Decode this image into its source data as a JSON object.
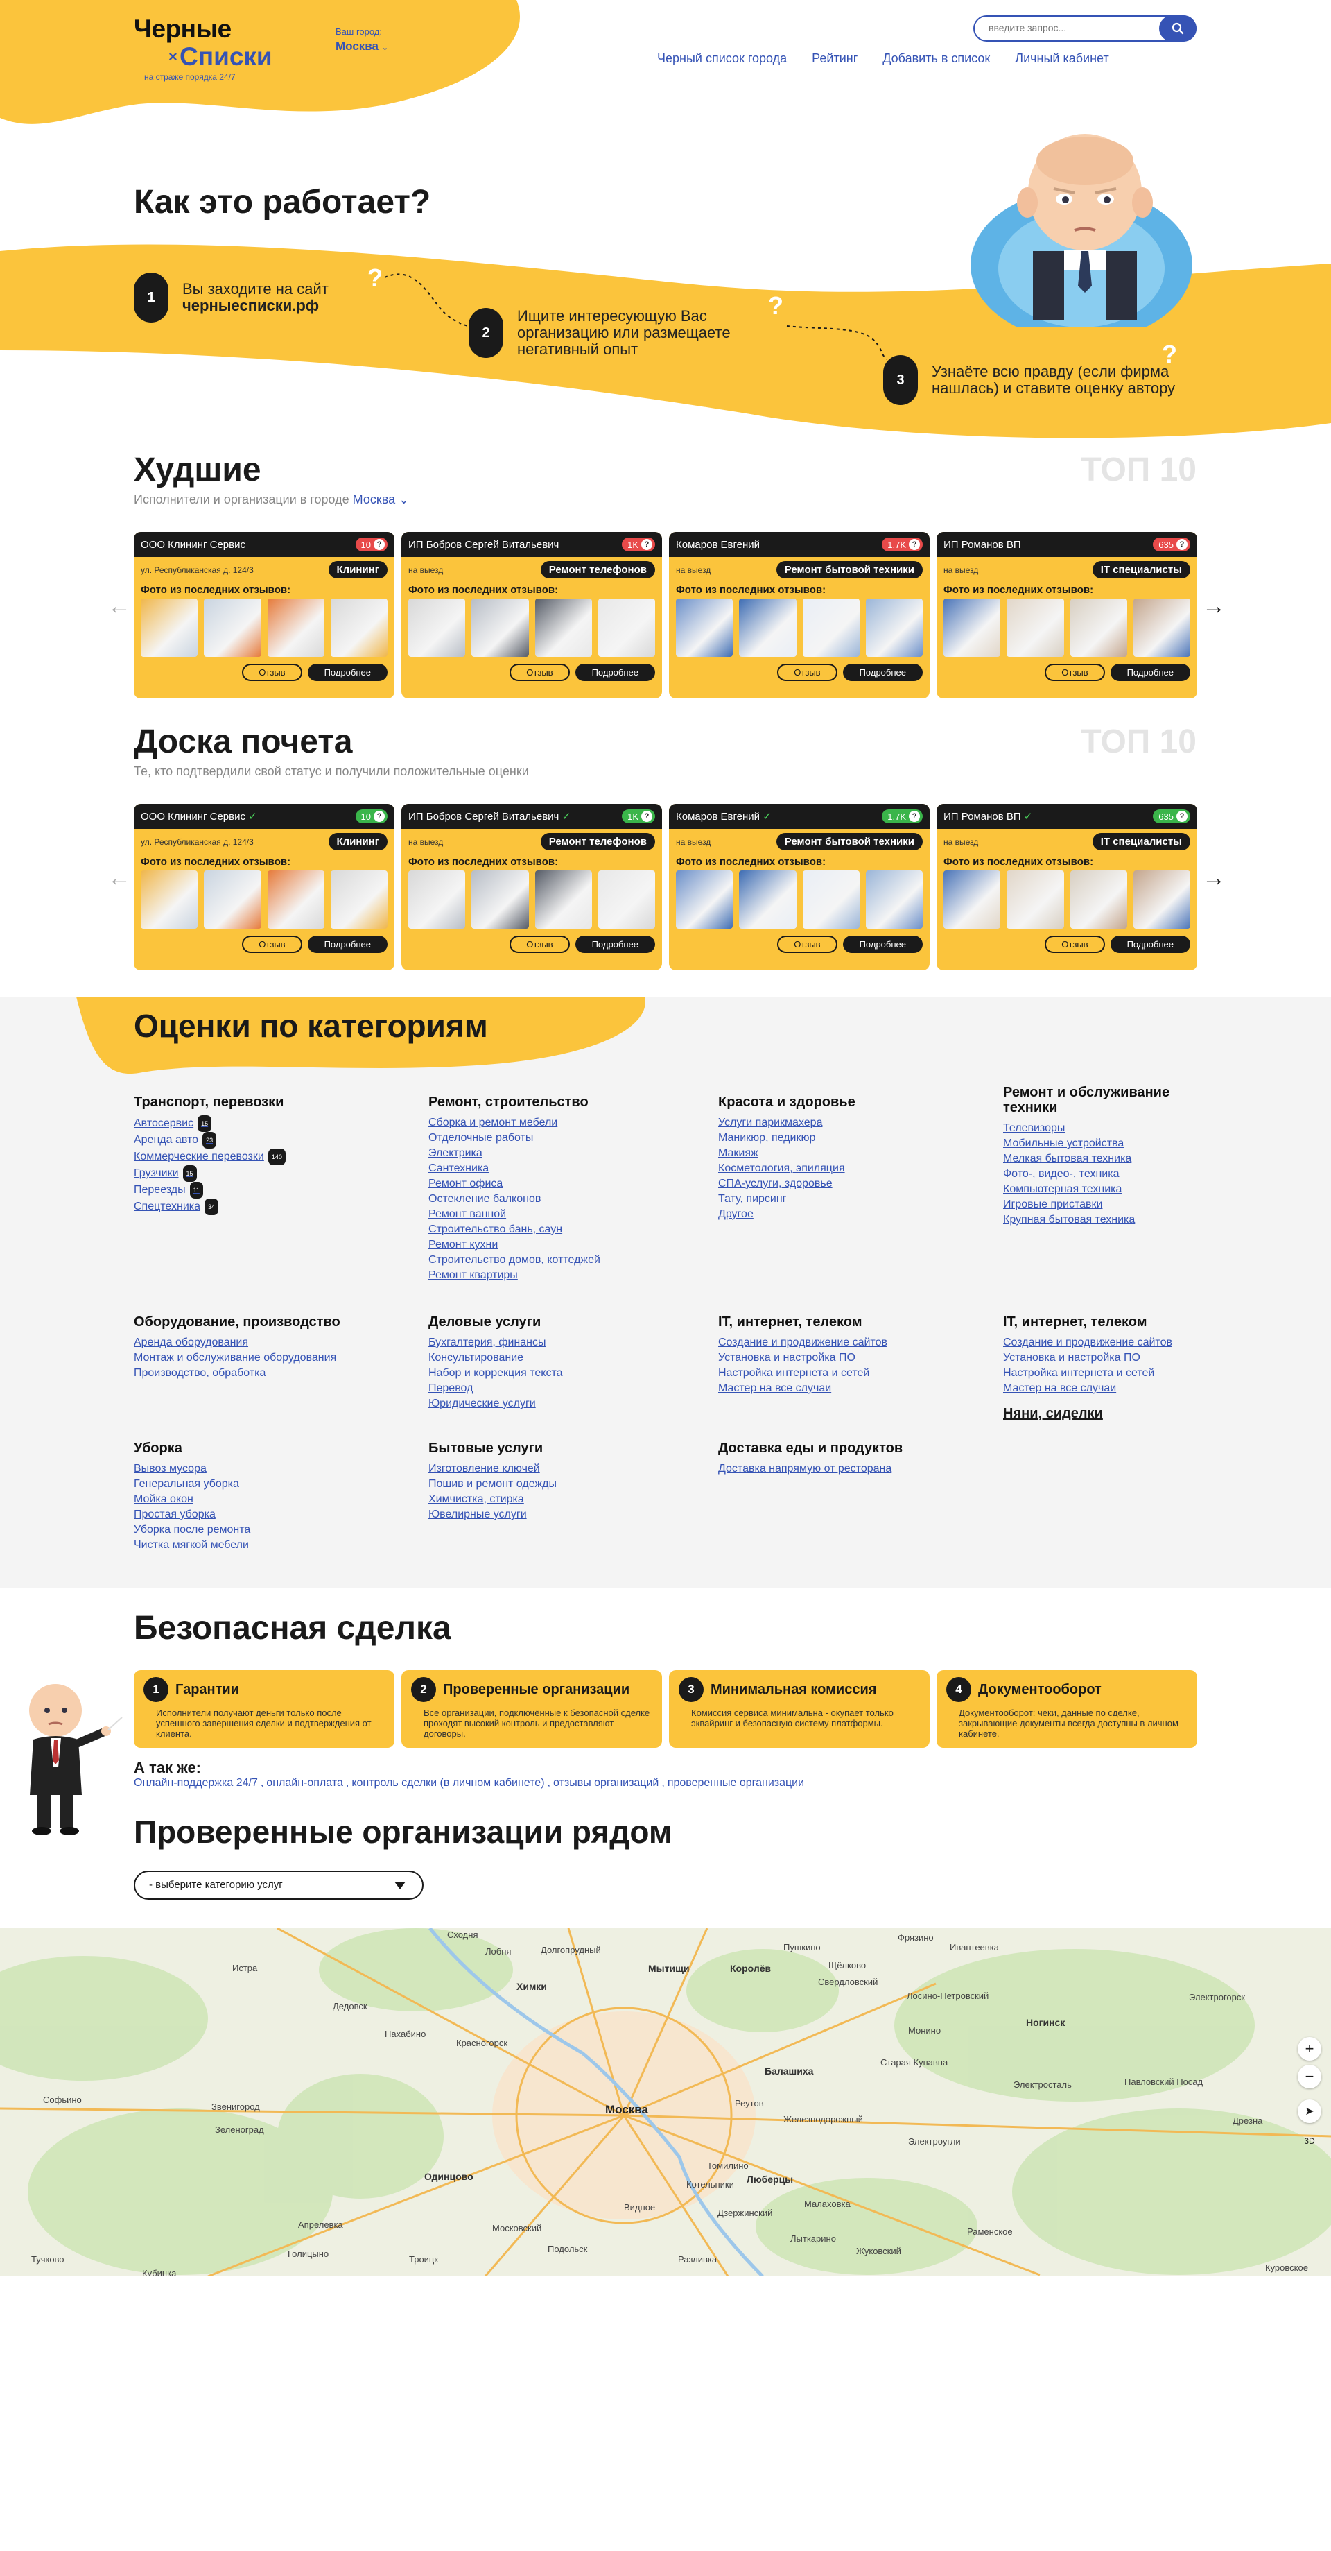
{
  "header": {
    "logo_line1": "Черные",
    "logo_line2": "Списки",
    "logo_mark": "×",
    "slogan": "на страже порядка 24/7",
    "city_label": "Ваш город:",
    "city_value": "Москва",
    "search_placeholder": "введите запрос...",
    "nav": [
      "Черный список города",
      "Рейтинг",
      "Добавить в список",
      "Личный кабинет"
    ]
  },
  "how": {
    "title": "Как это работает?",
    "steps": [
      {
        "num": "1",
        "text": "Вы заходите на сайт",
        "bold": "черныесписки.рф"
      },
      {
        "num": "2",
        "text": "Ищите интересующую Вас организацию или размещаете негативный опыт"
      },
      {
        "num": "3",
        "text": "Узнаёте всю правду (если фирма нашлась) и ставите оценку автору"
      }
    ]
  },
  "worst": {
    "title": "Худшие",
    "subtitle": "Исполнители и организации в городе",
    "city": "Москва",
    "top": "ТОП 10"
  },
  "honor": {
    "title": "Доска почета",
    "subtitle": "Те, кто подтвердили свой статус и получили положительные оценки",
    "top": "ТОП 10"
  },
  "cards": [
    {
      "name": "ООО Клининг Сервис",
      "count": "10",
      "address": "ул. Республиканская д. 124/3",
      "category": "Клининг"
    },
    {
      "name": "ИП Бобров Сергей Витальевич",
      "count": "1K",
      "address": "на выезд",
      "category": "Ремонт телефонов"
    },
    {
      "name": "Комаров Евгений",
      "count": "1.7K",
      "address": "на выезд",
      "category": "Ремонт бытовой техники"
    },
    {
      "name": "ИП Романов ВП",
      "count": "635",
      "address": "на выезд",
      "category": "IT специалисты"
    }
  ],
  "card_labels": {
    "photos": "Фото из последних отзывов:",
    "review": "Отзыв",
    "more": "Подробнее",
    "info": "?"
  },
  "categories": {
    "title": "Оценки по категориям",
    "groups": [
      {
        "title": "Транспорт, перевозки",
        "items": [
          {
            "t": "Автосервис",
            "c": "15"
          },
          {
            "t": "Аренда авто",
            "c": "23"
          },
          {
            "t": "Коммерческие перевозки",
            "c": "140"
          },
          {
            "t": "Грузчики",
            "c": "15"
          },
          {
            "t": "Переезды",
            "c": "11"
          },
          {
            "t": "Спецтехника",
            "c": "34"
          }
        ]
      },
      {
        "title": "Ремонт, строительство",
        "items": [
          {
            "t": "Сборка и ремонт мебели"
          },
          {
            "t": "Отделочные работы"
          },
          {
            "t": "Электрика"
          },
          {
            "t": "Сантехника"
          },
          {
            "t": "Ремонт офиса"
          },
          {
            "t": "Остекление балконов"
          },
          {
            "t": "Ремонт ванной"
          },
          {
            "t": "Строительство бань, саун"
          },
          {
            "t": "Ремонт кухни"
          },
          {
            "t": "Строительство домов, коттеджей"
          },
          {
            "t": "Ремонт квартиры"
          }
        ]
      },
      {
        "title": "Красота и здоровье",
        "items": [
          {
            "t": "Услуги парикмахера"
          },
          {
            "t": "Маникюр, педикюр"
          },
          {
            "t": "Макияж"
          },
          {
            "t": "Косметология, эпиляция"
          },
          {
            "t": "СПА-услуги, здоровье"
          },
          {
            "t": "Тату, пирсинг"
          },
          {
            "t": "Другое"
          }
        ]
      },
      {
        "title": "Ремонт и обслуживание техники",
        "items": [
          {
            "t": "Телевизоры"
          },
          {
            "t": "Мобильные устройства"
          },
          {
            "t": "Мелкая бытовая техника"
          },
          {
            "t": "Фото-, видео-, техника"
          },
          {
            "t": "Компьютерная техника"
          },
          {
            "t": "Игровые приставки"
          },
          {
            "t": "Крупная бытовая техника"
          }
        ]
      },
      {
        "title": "Оборудование, производство",
        "items": [
          {
            "t": "Аренда оборудования"
          },
          {
            "t": "Монтаж и обслуживание оборудования"
          },
          {
            "t": "Производство, обработка"
          }
        ]
      },
      {
        "title": "Деловые услуги",
        "items": [
          {
            "t": "Бухгалтерия, финансы"
          },
          {
            "t": "Консультирование"
          },
          {
            "t": "Набор и коррекция текста"
          },
          {
            "t": "Перевод"
          },
          {
            "t": "Юридические услуги"
          }
        ]
      },
      {
        "title": "IT, интернет, телеком",
        "items": [
          {
            "t": "Создание и продвижение сайтов"
          },
          {
            "t": "Установка и настройка ПО"
          },
          {
            "t": "Настройка интернета и сетей"
          },
          {
            "t": "Мастер на все случаи"
          }
        ]
      },
      {
        "title": "IT, интернет, телеком",
        "items": [
          {
            "t": "Создание и продвижение сайтов"
          },
          {
            "t": "Установка и настройка ПО"
          },
          {
            "t": "Настройка интернета и сетей"
          },
          {
            "t": "Мастер на все случаи"
          }
        ],
        "extra": "Няни, сиделки"
      },
      {
        "title": "Уборка",
        "items": [
          {
            "t": "Вывоз мусора"
          },
          {
            "t": "Генеральная уборка"
          },
          {
            "t": "Мойка окон"
          },
          {
            "t": "Простая уборка"
          },
          {
            "t": "Уборка после ремонта"
          },
          {
            "t": "Чистка мягкой мебели"
          }
        ]
      },
      {
        "title": "Бытовые услуги",
        "items": [
          {
            "t": "Изготовление ключей"
          },
          {
            "t": "Пошив и ремонт одежды"
          },
          {
            "t": "Химчистка, стирка"
          },
          {
            "t": "Ювелирные услуги"
          }
        ]
      },
      {
        "title": "Доставка еды и продуктов",
        "items": [
          {
            "t": "Доставка напрямую от ресторана"
          }
        ]
      }
    ]
  },
  "deal": {
    "title": "Безопасная сделка",
    "items": [
      {
        "num": "1",
        "title": "Гарантии",
        "text": "Исполнители получают деньги только после успешного завершения сделки и подтверждения от клиента."
      },
      {
        "num": "2",
        "title": "Проверенные организации",
        "text": "Все организации, подключённые к безопасной сделке проходят высокий контроль и предоставляют договоры."
      },
      {
        "num": "3",
        "title": "Минимальная комиссия",
        "text": "Комиссия сервиса минимальна - окупает только эквайринг и безопасную систему платформы."
      },
      {
        "num": "4",
        "title": "Документооборот",
        "text": "Документооборот: чеки, данные по сделке, закрывающие документы всегда доступны в личном кабинете."
      }
    ],
    "also_title": "А так же:",
    "also_links": [
      "Онлайн-поддержка 24/7",
      "онлайн-оплата",
      "контроль сделки (в личном кабинете)",
      "отзывы организаций",
      "проверенные организации"
    ]
  },
  "nearby": {
    "title": "Проверенные организации рядом",
    "select_value": "- выберите категорию услуг"
  },
  "map": {
    "labels": [
      "Москва",
      "Химки",
      "Мытищи",
      "Королёв",
      "Щёлково",
      "Балашиха",
      "Реутов",
      "Люберцы",
      "Красногорск",
      "Одинцово",
      "Зеленоград",
      "Лобня",
      "Долгопрудный",
      "Ногинск",
      "Электросталь",
      "Железнодорожный",
      "Старая Купавна",
      "Дзержинский",
      "Котельники",
      "Жуковский",
      "Раменское",
      "Подольск",
      "Видное",
      "Лыткарино",
      "Электроугли",
      "Фрязино",
      "Апрелевка",
      "Троицк",
      "Московский",
      "Истра",
      "Дедовск",
      "Нахабино",
      "Кубинка",
      "Голицыно",
      "Звенигород",
      "Пушкино",
      "Ивантеевка",
      "Сходня",
      "Свердловский",
      "Павловский Посад",
      "Дрезна",
      "Куровское",
      "Электрогорск",
      "Монино",
      "Лосино-Петровский",
      "Малаховка",
      "Томилино",
      "Разливка",
      "Тучково",
      "Софьино"
    ],
    "zoom_in": "+",
    "zoom_out": "−",
    "mode": "3D"
  }
}
